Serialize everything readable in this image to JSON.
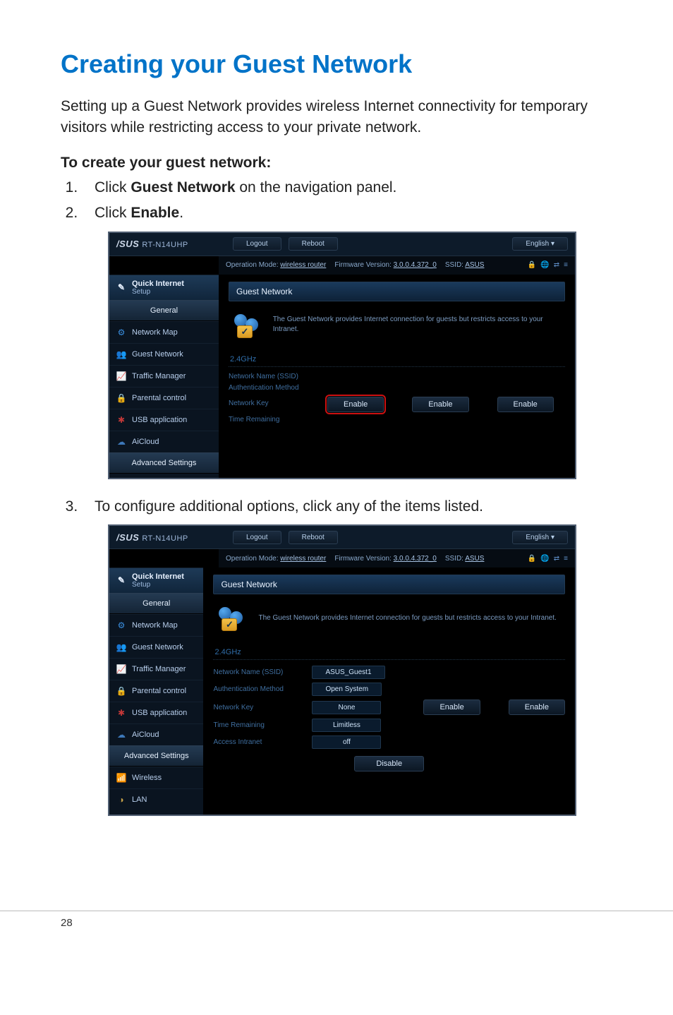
{
  "page": {
    "title": "Creating your Guest Network",
    "intro": "Setting up a Guest Network provides wireless Internet connectivity for temporary visitors while restricting access to your private network.",
    "subhead": "To create your guest network:",
    "step1_pre": "Click ",
    "step1_bold": "Guest Network",
    "step1_post": " on the navigation panel.",
    "step2_pre": "Click ",
    "step2_bold": "Enable",
    "step2_post": ".",
    "step3": "To configure additional options, click any of the items listed.",
    "number": "28"
  },
  "router": {
    "brand": "/SUS",
    "model": "RT-N14UHP",
    "logout": "Logout",
    "reboot": "Reboot",
    "language": "English",
    "op_mode_label": "Operation Mode:",
    "op_mode_value": "wireless router",
    "fw_label": "Firmware Version:",
    "fw_value": "3.0.0.4.372_0",
    "ssid_label": "SSID:",
    "ssid_value": "ASUS",
    "panel_title": "Guest Network",
    "desc": "The Guest Network provides Internet connection for guests but restricts access to your Intranet.",
    "band": "2.4GHz",
    "btn_enable": "Enable",
    "btn_disable": "Disable",
    "sidebar": {
      "qis_title": "Quick Internet",
      "qis_sub": "Setup",
      "general": "General",
      "map": "Network Map",
      "guest": "Guest Network",
      "traffic": "Traffic Manager",
      "parental": "Parental control",
      "usb": "USB application",
      "cloud": "AiCloud",
      "adv": "Advanced Settings",
      "wireless": "Wireless",
      "lan": "LAN"
    },
    "fields": {
      "name_k": "Network Name (SSID)",
      "auth_k": "Authentication Method",
      "key_k": "Network Key",
      "time_k": "Time Remaining",
      "intra_k": "Access Intranet",
      "name_v": "ASUS_Guest1",
      "auth_v": "Open System",
      "key_v": "None",
      "time_v": "Limitless",
      "intra_v": "off"
    }
  }
}
